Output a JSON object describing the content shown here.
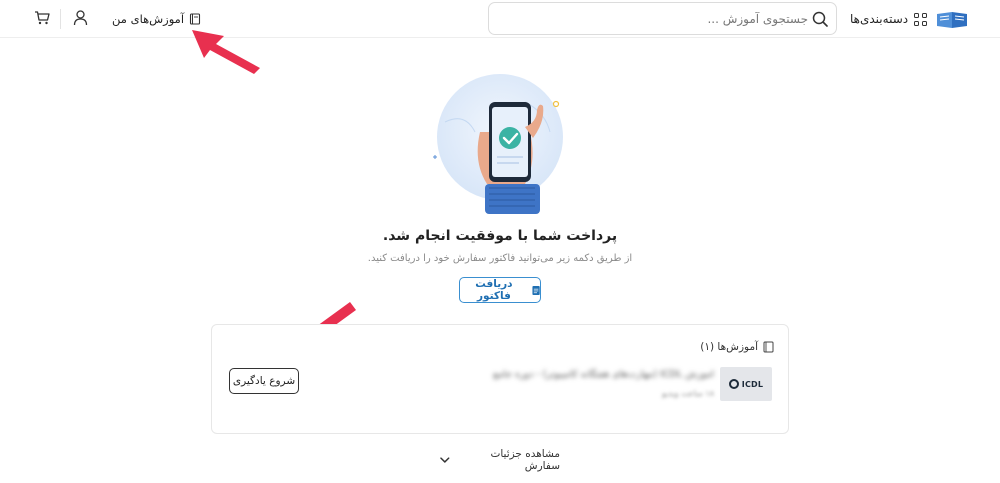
{
  "header": {
    "categories_label": "دسته‌بندی‌ها",
    "search_placeholder": "جستجوی آموزش ...",
    "my_courses_label": "آموزش‌های من"
  },
  "success": {
    "title": "پرداخت شما با موفقیت انجام شد.",
    "subtitle": "از طریق دکمه زیر می‌توانید فاکتور سفارش خود را دریافت کنید.",
    "invoice_button": "دریافت فاکتور"
  },
  "courses_card": {
    "title": "آموزش‌ها (۱)",
    "items": [
      {
        "thumb_text": "ICDL",
        "name": "آموزش ICDL (مهارت‌های هفتگانه کامپیوتر) - دوره جامع",
        "meta": "۱۸ ساعت ویدیو",
        "start_button": "شروع یادگیری"
      }
    ]
  },
  "footer": {
    "order_details_label": "مشاهده جزئیات سفارش"
  },
  "colors": {
    "accent_blue": "#1f6fb2",
    "arrow_red": "#e8304f",
    "success_teal": "#3bb3a4"
  }
}
